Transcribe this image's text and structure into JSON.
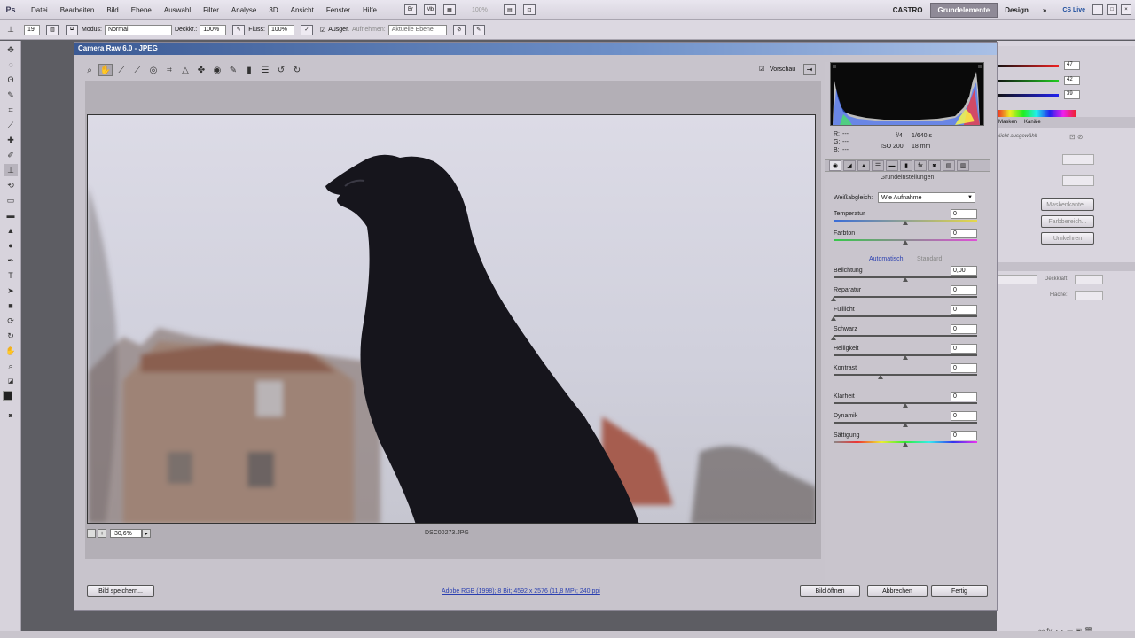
{
  "app": {
    "logo": "Ps",
    "menu": [
      "Datei",
      "Bearbeiten",
      "Bild",
      "Ebene",
      "Auswahl",
      "Filter",
      "Analyse",
      "3D",
      "Ansicht",
      "Fenster",
      "Hilfe"
    ],
    "zoom_display": "100%",
    "workspace_user": "CASTRO",
    "workspaces": [
      "Grundelemente",
      "Design"
    ],
    "more": "»",
    "cs_live": "CS Live"
  },
  "options": {
    "brush_size": "19",
    "modus_label": "Modus:",
    "modus_value": "Normal",
    "deckkraft_label": "Deckkr.:",
    "deckkraft_value": "100%",
    "fluss_label": "Fluss:",
    "fluss_value": "100%",
    "ausger_label": "Ausger.",
    "aufnehmen_label": "Aufnehmen:",
    "aufnehmen_value": "Aktuelle Ebene"
  },
  "dialog": {
    "title": "Camera Raw 6.0  -  JPEG",
    "vorschau_label": "Vorschau",
    "zoom_value": "30,6%",
    "filename": "DSC00273.JPG",
    "workflow_link": "Adobe RGB (1998); 8 Bit; 4592 x 2576 (11,8 MP); 240 ppi",
    "buttons": {
      "save": "Bild speichern...",
      "open": "Bild öffnen",
      "cancel": "Abbrechen",
      "done": "Fertig"
    }
  },
  "camera_info": {
    "r": "R:",
    "g": "G:",
    "b": "B:",
    "r_val": "---",
    "g_val": "---",
    "b_val": "---",
    "aperture": "f/4",
    "shutter": "1/640 s",
    "iso": "ISO 200",
    "focal": "18 mm"
  },
  "basic_panel": {
    "title": "Grundeinstellungen",
    "wb_label": "Weißabgleich:",
    "wb_value": "Wie Aufnahme",
    "auto_label": "Automatisch",
    "default_label": "Standard",
    "sliders": [
      {
        "label": "Temperatur",
        "value": "0",
        "pos": 0.5
      },
      {
        "label": "Farbton",
        "value": "0",
        "pos": 0.5
      },
      {
        "label": "Belichtung",
        "value": "0,00",
        "pos": 0.5
      },
      {
        "label": "Reparatur",
        "value": "0",
        "pos": 0.0
      },
      {
        "label": "Fülllicht",
        "value": "0",
        "pos": 0.0
      },
      {
        "label": "Schwarz",
        "value": "0",
        "pos": 0.0
      },
      {
        "label": "Helligkeit",
        "value": "0",
        "pos": 0.5
      },
      {
        "label": "Kontrast",
        "value": "0",
        "pos": 0.33
      },
      {
        "label": "Klarheit",
        "value": "0",
        "pos": 0.5
      },
      {
        "label": "Dynamik",
        "value": "0",
        "pos": 0.5
      },
      {
        "label": "Sättigung",
        "value": "0",
        "pos": 0.5
      }
    ]
  },
  "right_panels": {
    "rgb_values": [
      "47",
      "42",
      "39"
    ],
    "tab_masks": "Masken",
    "tab_kanale": "Kanäle",
    "no_selection": "Nicht ausgewählt",
    "btn_maskenkante": "Maskenkante...",
    "btn_farbbereich": "Farbbereich...",
    "btn_umkehren": "Umkehren",
    "deckkraft_label": "Deckkraft:",
    "flache_label": "Fläche:"
  },
  "colors": {
    "accent_title": "#3b5a94",
    "link": "#2a3fb0"
  }
}
